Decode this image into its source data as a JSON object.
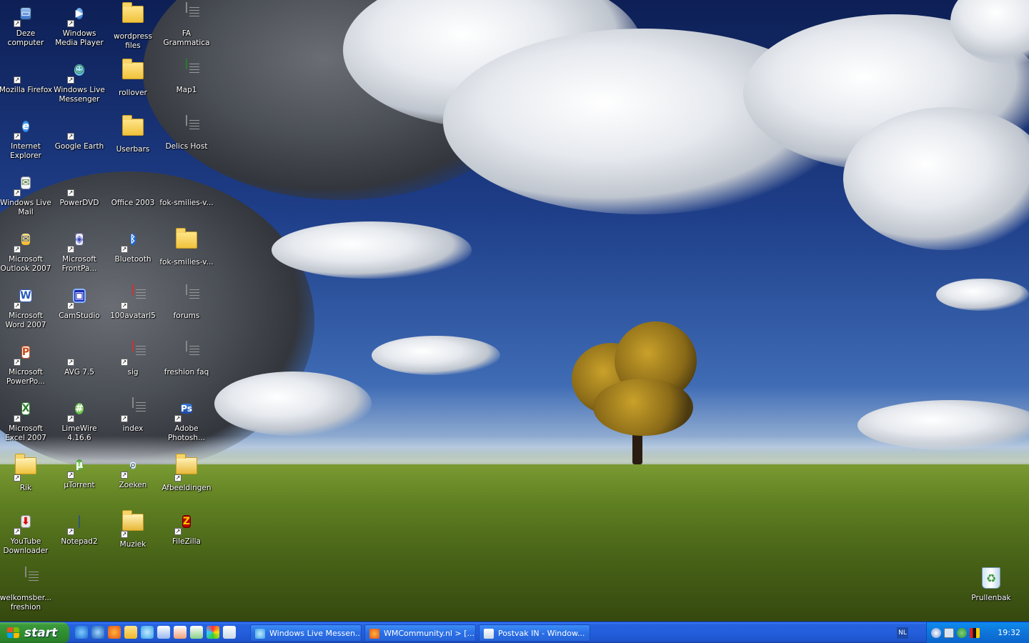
{
  "desktop": {
    "icons": [
      {
        "label": "Deze computer",
        "icon": "computer-icon"
      },
      {
        "label": "Windows Media Player",
        "icon": "media-player-icon"
      },
      {
        "label": "wordpress files",
        "icon": "folder-icon"
      },
      {
        "label": "FA Grammatica",
        "icon": "word-doc-icon"
      },
      {
        "label": "Mozilla Firefox",
        "icon": "firefox-icon"
      },
      {
        "label": "Windows Live Messenger",
        "icon": "messenger-icon"
      },
      {
        "label": "rollover",
        "icon": "folder-icon"
      },
      {
        "label": "Map1",
        "icon": "excel-doc-icon"
      },
      {
        "label": "Internet Explorer",
        "icon": "internet-explorer-icon"
      },
      {
        "label": "Google Earth",
        "icon": "google-earth-icon"
      },
      {
        "label": "Userbars",
        "icon": "folder-icon"
      },
      {
        "label": "Delics Host",
        "icon": "text-doc-icon"
      },
      {
        "label": "Windows Live Mail",
        "icon": "mail-icon"
      },
      {
        "label": "PowerDVD",
        "icon": "dvd-icon"
      },
      {
        "label": "Office 2003",
        "icon": "archive-icon"
      },
      {
        "label": "fok-smilies-v...",
        "icon": "archive-icon"
      },
      {
        "label": "Microsoft Outlook 2007",
        "icon": "outlook-icon"
      },
      {
        "label": "Microsoft FrontPa...",
        "icon": "frontpage-icon"
      },
      {
        "label": "Bluetooth",
        "icon": "bluetooth-icon"
      },
      {
        "label": "fok-smilies-v...",
        "icon": "folder-icon"
      },
      {
        "label": "Microsoft Word 2007",
        "icon": "word-icon"
      },
      {
        "label": "CamStudio",
        "icon": "camstudio-icon"
      },
      {
        "label": "100avatarl5",
        "icon": "image-icon"
      },
      {
        "label": "forums",
        "icon": "text-doc-icon"
      },
      {
        "label": "Microsoft PowerPo...",
        "icon": "powerpoint-icon"
      },
      {
        "label": "AVG 7.5",
        "icon": "avg-icon"
      },
      {
        "label": "sig",
        "icon": "image-icon"
      },
      {
        "label": "freshion faq",
        "icon": "text-doc-icon"
      },
      {
        "label": "Microsoft Excel 2007",
        "icon": "excel-icon"
      },
      {
        "label": "LimeWire 4.16.6",
        "icon": "limewire-icon"
      },
      {
        "label": "index",
        "icon": "firefox-doc-icon"
      },
      {
        "label": "Adobe Photosh...",
        "icon": "photoshop-icon"
      },
      {
        "label": "Rik",
        "icon": "user-folder-icon"
      },
      {
        "label": "µTorrent",
        "icon": "utorrent-icon"
      },
      {
        "label": "Zoeken",
        "icon": "search-icon"
      },
      {
        "label": "Afbeeldingen",
        "icon": "pictures-folder-icon"
      },
      {
        "label": "YouTube Downloader",
        "icon": "download-icon"
      },
      {
        "label": "Notepad2",
        "icon": "notepad-icon"
      },
      {
        "label": "Muziek",
        "icon": "music-folder-icon"
      },
      {
        "label": "FileZilla",
        "icon": "filezilla-icon"
      },
      {
        "label": "welkomsber... freshion",
        "icon": "text-doc-icon"
      }
    ],
    "recycle_bin": {
      "label": "Prullenbak",
      "icon": "recycle-bin-icon"
    }
  },
  "taskbar": {
    "start_label": "start",
    "quick_launch": [
      "internet-explorer-icon",
      "media-player-icon",
      "firefox-icon",
      "outlook-icon",
      "messenger-icon",
      "word-icon",
      "powerpoint-icon",
      "excel-icon",
      "paint-icon",
      "mail-icon"
    ],
    "windows": [
      {
        "label": "Windows Live Messen...",
        "icon": "messenger-icon"
      },
      {
        "label": "WMCommunity.nl > [...",
        "icon": "firefox-icon"
      },
      {
        "label": "Postvak IN - Window...",
        "icon": "mail-icon"
      }
    ],
    "language": "NL",
    "clock": "19:32"
  },
  "colors": {
    "taskbar": "#245edc",
    "start": "#2f8f2f",
    "tray": "#0e74d9"
  }
}
